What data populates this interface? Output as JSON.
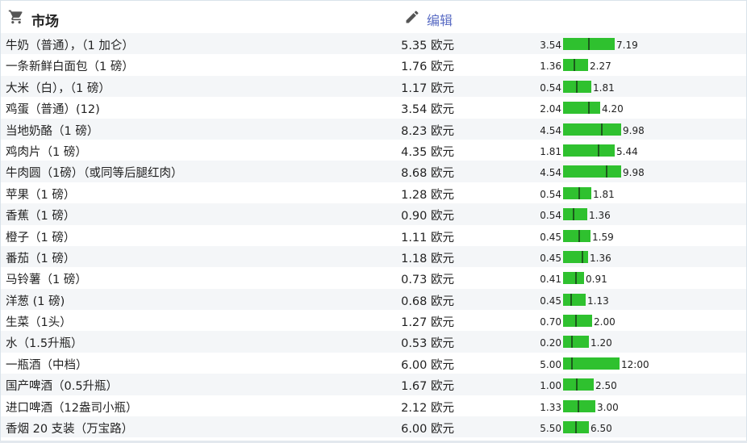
{
  "header": {
    "title": "市场",
    "edit_label": "编辑",
    "cart_icon": "shopping-cart-icon",
    "edit_icon": "pencil-icon"
  },
  "colors": {
    "bar": "#2fc12f",
    "tick": "#1c5a1c",
    "edit_link": "#5a6cc4"
  },
  "items": [
    {
      "name": "牛奶（普通），（1 加仑）",
      "price": "5.35 欧元",
      "min": "3.54",
      "max": "7.19",
      "min_v": 3.54,
      "max_v": 7.19,
      "val": 5.35
    },
    {
      "name": "一条新鲜白面包（1 磅）",
      "price": "1.76 欧元",
      "min": "1.36",
      "max": "2.27",
      "min_v": 1.36,
      "max_v": 2.27,
      "val": 1.76
    },
    {
      "name": "大米（白），（1 磅）",
      "price": "1.17 欧元",
      "min": "0.54",
      "max": "1.81",
      "min_v": 0.54,
      "max_v": 1.81,
      "val": 1.17
    },
    {
      "name": "鸡蛋（普通）(12)",
      "price": "3.54 欧元",
      "min": "2.04",
      "max": "4.20",
      "min_v": 2.04,
      "max_v": 4.2,
      "val": 3.54
    },
    {
      "name": "当地奶酪（1 磅）",
      "price": "8.23 欧元",
      "min": "4.54",
      "max": "9.98",
      "min_v": 4.54,
      "max_v": 9.98,
      "val": 8.23
    },
    {
      "name": "鸡肉片（1 磅）",
      "price": "4.35 欧元",
      "min": "1.81",
      "max": "5.44",
      "min_v": 1.81,
      "max_v": 5.44,
      "val": 4.35
    },
    {
      "name": "牛肉圆（1磅）（或同等后腿红肉）",
      "price": "8.68 欧元",
      "min": "4.54",
      "max": "9.98",
      "min_v": 4.54,
      "max_v": 9.98,
      "val": 8.68
    },
    {
      "name": "苹果（1 磅）",
      "price": "1.28 欧元",
      "min": "0.54",
      "max": "1.81",
      "min_v": 0.54,
      "max_v": 1.81,
      "val": 1.28
    },
    {
      "name": "香蕉（1 磅）",
      "price": "0.90 欧元",
      "min": "0.54",
      "max": "1.36",
      "min_v": 0.54,
      "max_v": 1.36,
      "val": 0.9
    },
    {
      "name": "橙子（1 磅）",
      "price": "1.11 欧元",
      "min": "0.45",
      "max": "1.59",
      "min_v": 0.45,
      "max_v": 1.59,
      "val": 1.11
    },
    {
      "name": "番茄（1 磅）",
      "price": "1.18 欧元",
      "min": "0.45",
      "max": "1.36",
      "min_v": 0.45,
      "max_v": 1.36,
      "val": 1.18
    },
    {
      "name": "马铃薯（1 磅）",
      "price": "0.73 欧元",
      "min": "0.41",
      "max": "0.91",
      "min_v": 0.41,
      "max_v": 0.91,
      "val": 0.73
    },
    {
      "name": "洋葱 (1 磅)",
      "price": "0.68 欧元",
      "min": "0.45",
      "max": "1.13",
      "min_v": 0.45,
      "max_v": 1.13,
      "val": 0.68
    },
    {
      "name": "生菜（1头）",
      "price": "1.27 欧元",
      "min": "0.70",
      "max": "2.00",
      "min_v": 0.7,
      "max_v": 2.0,
      "val": 1.27
    },
    {
      "name": "水（1.5升瓶）",
      "price": "0.53 欧元",
      "min": "0.20",
      "max": "1.20",
      "min_v": 0.2,
      "max_v": 1.2,
      "val": 0.53
    },
    {
      "name": "一瓶酒（中档）",
      "price": "6.00 欧元",
      "min": "5.00",
      "max": "12:00",
      "min_v": 5.0,
      "max_v": 12.0,
      "val": 6.0
    },
    {
      "name": "国产啤酒（0.5升瓶）",
      "price": "1.67 欧元",
      "min": "1.00",
      "max": "2.50",
      "min_v": 1.0,
      "max_v": 2.5,
      "val": 1.67
    },
    {
      "name": "进口啤酒（12盎司小瓶）",
      "price": "2.12 欧元",
      "min": "1.33",
      "max": "3.00",
      "min_v": 1.33,
      "max_v": 3.0,
      "val": 2.12
    },
    {
      "name": "香烟 20 支装（万宝路）",
      "price": "6.00 欧元",
      "min": "5.50",
      "max": "6.50",
      "min_v": 5.5,
      "max_v": 6.5,
      "val": 6.0
    }
  ]
}
